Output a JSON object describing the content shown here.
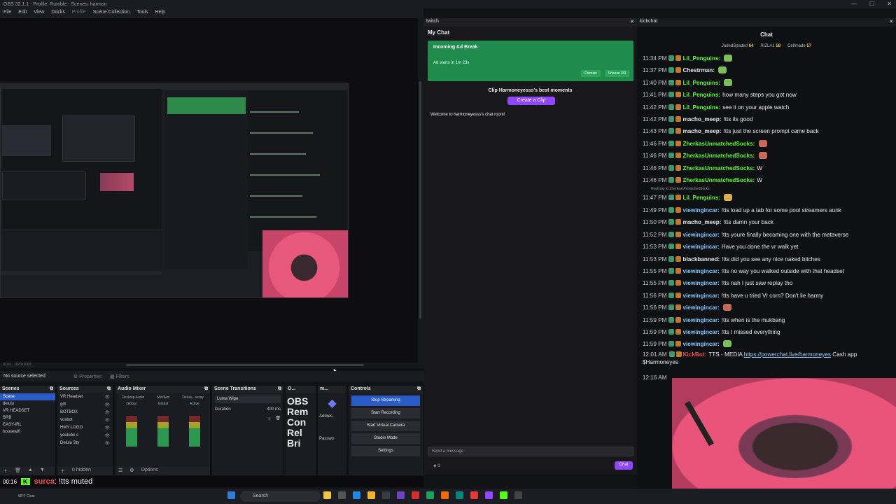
{
  "obs": {
    "title": "OBS 32.1.1 - Profile: Rumble - Scenes: harmon",
    "menu": [
      "File",
      "Edit",
      "View",
      "Docks",
      "Profile",
      "Scene Collection",
      "Tools",
      "Help"
    ],
    "no_source": "No source selected",
    "properties_label": "Properties",
    "filters_label": "Filters",
    "status_line": "0:0% · 1920x1080",
    "docks": {
      "scenes": {
        "title": "Scenes",
        "items": [
          "Scene",
          "delulu",
          "VR HEADSET",
          "BRB",
          "EASY-IRL",
          "housewifi"
        ]
      },
      "sources": {
        "title": "Sources",
        "items": [
          "VR Headset",
          "gift",
          "BOTBOX",
          "voxbot",
          "HMY LOGO",
          "youtube c",
          "Delulu Sty"
        ],
        "hidden": "0 hidden"
      },
      "mixer": {
        "title": "Audio Mixer",
        "channels": [
          "Desktop Audio",
          "Mic/Aux",
          "Delulu...veray"
        ],
        "labels": [
          "Global",
          "Global",
          "Active"
        ]
      },
      "transitions": {
        "title": "Scene Transitions",
        "selected": "Luma Wipe",
        "duration_label": "Duration",
        "duration_value": "400 ms"
      },
      "obs_panel": {
        "title": "O...",
        "big_text": "OBS Rem Con Rel Bri",
        "address": "Addres",
        "password": "Passwo"
      },
      "panel_m": {
        "title": "m..."
      },
      "controls": {
        "title": "Controls",
        "buttons": [
          "Stop Streaming",
          "Start Recording",
          "Start Virtual Camera",
          "Studio Mode",
          "Settings"
        ]
      }
    },
    "options_label": "Options"
  },
  "overlay": {
    "time": "00:16",
    "badge": "K",
    "user": "surca",
    "text": ": !tts muted"
  },
  "taskbar": {
    "weather": "68°F Clear",
    "search": "Search"
  },
  "twitch": {
    "panel_title": "twitch",
    "chat_title": "My Chat",
    "ad_title": "Incoming Ad Break",
    "ad_sub": "Ad starts in 1m 23s",
    "dismiss": "Dismiss",
    "snooze": "Snooze 3/3",
    "clip_title": "Clip Harmoneyesss's best moments",
    "clip_btn": "Create a Clip",
    "welcome": "Welcome to harmoneyesss's chat room!",
    "send_placeholder": "Send a message",
    "chat_btn": "Chat",
    "points": "0"
  },
  "kick": {
    "panel_title": "kickchat",
    "chat_label": "Chat",
    "leaders": [
      {
        "name": "JadedSpaded",
        "score": "64"
      },
      {
        "name": "RIZLA1",
        "score": "58"
      },
      {
        "name": "Celfmade",
        "score": "57"
      }
    ],
    "messages": [
      {
        "time": "11:34 PM",
        "user": "Lil_Penguins:",
        "color": "#53fc18",
        "text": "",
        "emote": "e1"
      },
      {
        "time": "11:37 PM",
        "user": "Chestrman:",
        "color": "#e9e9ec",
        "text": "",
        "emote": "e1"
      },
      {
        "time": "11:40 PM",
        "user": "Lil_Penguins:",
        "color": "#53fc18",
        "text": "",
        "emote": "e1"
      },
      {
        "time": "11:41 PM",
        "user": "Lil_Penguins:",
        "color": "#53fc18",
        "text": "how many steps you got now"
      },
      {
        "time": "11:42 PM",
        "user": "Lil_Penguins:",
        "color": "#53fc18",
        "text": "see it on your apple watch"
      },
      {
        "time": "11:42 PM",
        "user": "macho_meep:",
        "color": "#e9e9ec",
        "text": "!tts its good"
      },
      {
        "time": "11:43 PM",
        "user": "macho_meep:",
        "color": "#e9e9ec",
        "text": "!tts just the screen prompt came back"
      },
      {
        "time": "11:46 PM",
        "user": "ZherkasUnmatchedSocks:",
        "color": "#53fc18",
        "text": "",
        "emote": "e2"
      },
      {
        "time": "11:46 PM",
        "user": "ZherkasUnmatchedSocks:",
        "color": "#53fc18",
        "text": "",
        "emote": "e2"
      },
      {
        "time": "11:46 PM",
        "user": "ZherkasUnmatchedSocks:",
        "color": "#53fc18",
        "text": "W"
      },
      {
        "time": "11:46 PM",
        "user": "ZherkasUnmatchedSocks:",
        "color": "#53fc18",
        "text": "W"
      },
      {
        "time": "11:47 PM",
        "user": "Lil_Penguins:",
        "color": "#53fc18",
        "text": "",
        "emote": "e3",
        "reply": "Replying to ZherkasUnmatchedSocks:"
      },
      {
        "time": "11:49 PM",
        "user": "viewingincar:",
        "color": "#7ec8ff",
        "text": "!tts load up a tab for some pool streamers aunk"
      },
      {
        "time": "11:50 PM",
        "user": "macho_meep:",
        "color": "#e9e9ec",
        "text": "!tts damn your back"
      },
      {
        "time": "11:52 PM",
        "user": "viewingincar:",
        "color": "#7ec8ff",
        "text": "!tts youre finally becoming one with the metaverse"
      },
      {
        "time": "11:53 PM",
        "user": "viewingincar:",
        "color": "#7ec8ff",
        "text": "Have you done the vr walk yet"
      },
      {
        "time": "11:53 PM",
        "user": "blackbanned:",
        "color": "#e9e9ec",
        "text": "!tts did you see any nice naked bitches"
      },
      {
        "time": "11:55 PM",
        "user": "viewingincar:",
        "color": "#7ec8ff",
        "text": "!tts no way you walked outside with that headset"
      },
      {
        "time": "11:55 PM",
        "user": "viewingincar:",
        "color": "#7ec8ff",
        "text": "!tts nah I just saw replay tho"
      },
      {
        "time": "11:56 PM",
        "user": "viewingincar:",
        "color": "#7ec8ff",
        "text": "!tts have u tried Vr corn? Don't lie harmy"
      },
      {
        "time": "11:56 PM",
        "user": "viewingincar:",
        "color": "#7ec8ff",
        "text": "",
        "emote": "e2"
      },
      {
        "time": "11:59 PM",
        "user": "viewingincar:",
        "color": "#7ec8ff",
        "text": "!tts when is the mukbang"
      },
      {
        "time": "11:59 PM",
        "user": "viewingincar:",
        "color": "#7ec8ff",
        "text": "!tts I missed everything"
      },
      {
        "time": "11:59 PM",
        "user": "viewingincar:",
        "color": "#7ec8ff",
        "text": "",
        "emote": "e1"
      },
      {
        "time": "12:01 AM",
        "user": "KickBot:",
        "color": "#f04a4a",
        "text": "TTS - MEDIA",
        "link": "https://powerchat.live/harmoneyes",
        "after": "Cash app $Harmoneyes"
      }
    ],
    "last_time": "12:16 AM"
  }
}
